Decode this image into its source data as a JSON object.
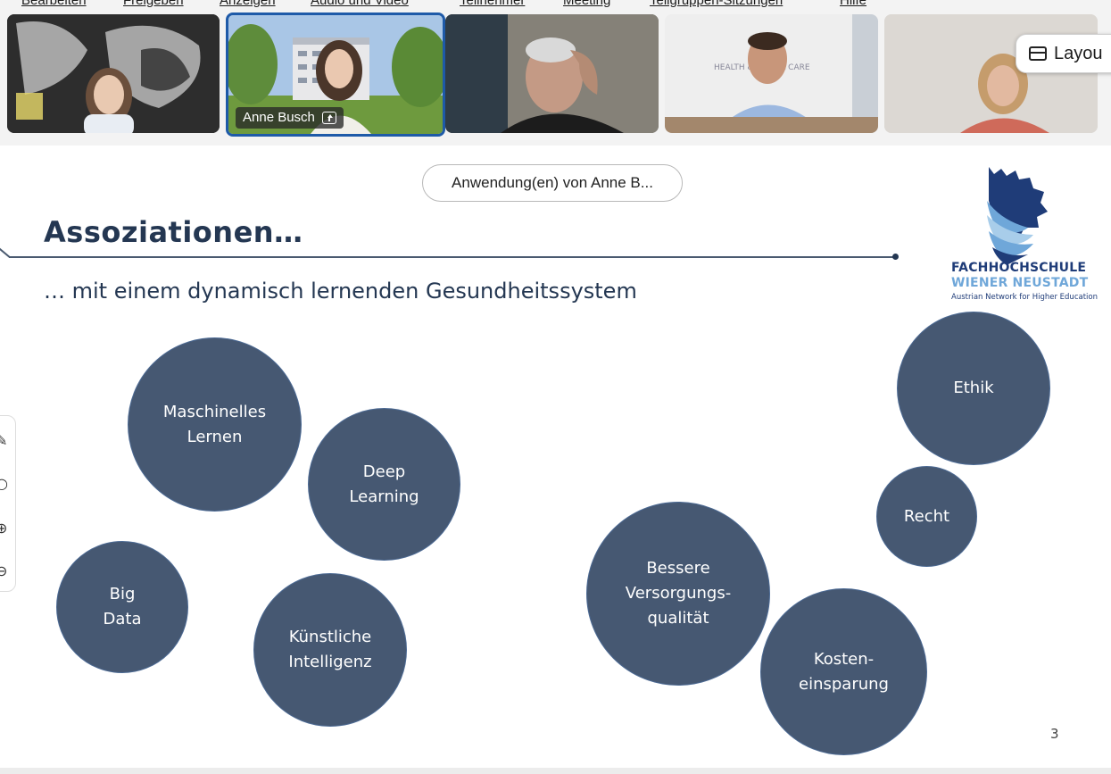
{
  "menu": {
    "items": [
      "Bearbeiten",
      "Freigeben",
      "Anzeigen",
      "Audio und Video",
      "Teilnehmer",
      "Meeting",
      "Teilgruppen-Sitzungen",
      "Hilfe"
    ]
  },
  "participants": [
    {
      "name": "",
      "active": false
    },
    {
      "name": "Anne Busch",
      "active": true
    },
    {
      "name": "",
      "active": false
    },
    {
      "name": "",
      "active": false
    },
    {
      "name": "",
      "active": false
    }
  ],
  "layout_button": {
    "label": "Layou"
  },
  "share_notice": "Anwendung(en) von Anne B...",
  "slide": {
    "title": "Assoziationen…",
    "subtitle": "… mit einem dynamisch lernenden Gesundheitssystem",
    "logo": {
      "line1": "FACHHOCHSCHULE",
      "line2": "WIENER NEUSTADT",
      "tagline": "Austrian Network for Higher Education"
    },
    "bubbles": [
      "Maschinelles\nLernen",
      "Deep\nLearning",
      "Big\nData",
      "Künstliche\nIntelligenz",
      "Bessere\nVersorgungs-\nqualität",
      "Kosten-\neinsparung",
      "Ethik",
      "Recht"
    ],
    "page_number": "3"
  },
  "colors": {
    "bubble_fill": "#465872",
    "title_navy": "#243752",
    "logo_blue": "#1f3c78",
    "logo_light_blue": "#6fa7d9",
    "active_border": "#1e5aa8"
  }
}
